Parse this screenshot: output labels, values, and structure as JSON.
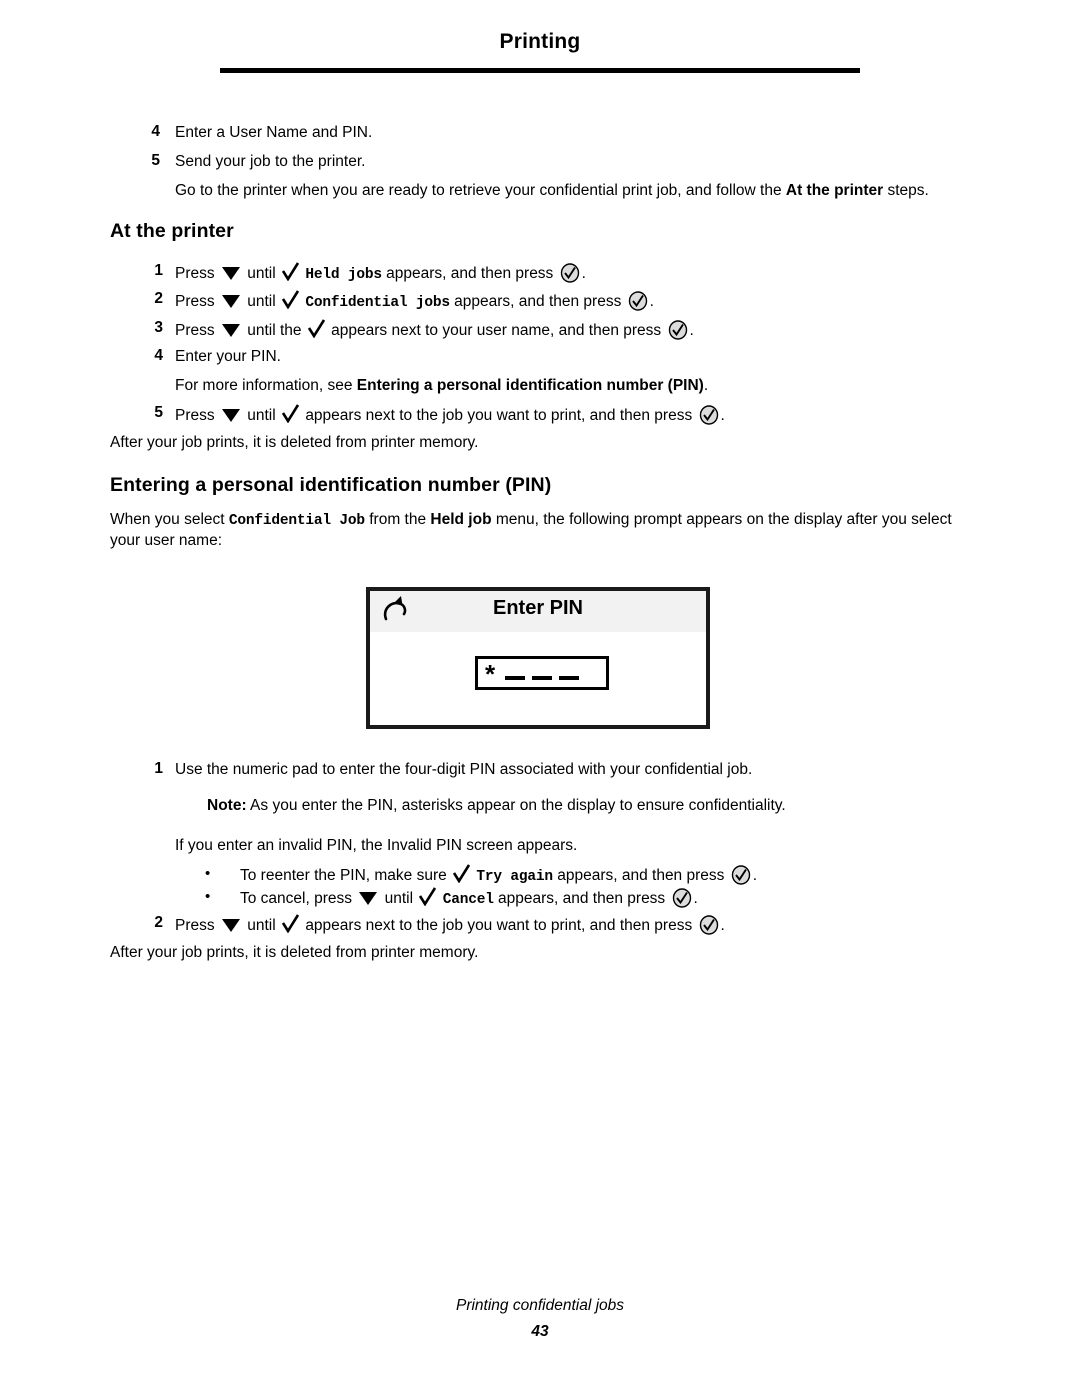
{
  "header": {
    "title": "Printing"
  },
  "intro_steps": [
    {
      "num": "4",
      "text": "Enter a User Name and PIN."
    },
    {
      "num": "5",
      "text": "Send your job to the printer."
    }
  ],
  "intro_paragraph": {
    "lead": "Go to the printer when you are ready to retrieve your confidential print job, and follow the ",
    "bold": "At the printer",
    "tail": " steps."
  },
  "at_printer": {
    "heading": "At the printer",
    "steps": [
      {
        "num": "1",
        "pre": "Press",
        "mid": "until",
        "mono": "Held jobs",
        "post": "appears, and then press",
        "end": "."
      },
      {
        "num": "2",
        "pre": "Press",
        "mid": "until",
        "mono": "Confidential jobs",
        "post": "appears, and then press",
        "end": "."
      },
      {
        "num": "3",
        "pre": "Press",
        "mid": "until the",
        "mono": "",
        "post": "appears next to your user name, and then press",
        "end": "."
      }
    ],
    "step4": {
      "num": "4",
      "text": "Enter your PIN."
    },
    "more_info": {
      "lead": "For more information, see ",
      "bold": "Entering a personal identification number (PIN)",
      "tail": "."
    },
    "step5": {
      "num": "5",
      "pre": "Press",
      "mid": "until",
      "post": "appears next to the job you want to print, and then press",
      "end": "."
    },
    "after_note": "After your job prints, it is deleted from printer memory."
  },
  "pin_section": {
    "heading": "Entering a personal identification number (PIN)",
    "paragraph": {
      "lead": "When you select ",
      "mono": "Confidential Job",
      "mid": " from the ",
      "bold": "Held job",
      "tail": " menu, the following prompt appears on the display after you select your user name:"
    },
    "display_panel": {
      "back_icon": "back-arrow-icon",
      "title": "Enter PIN",
      "pin_value": "*",
      "pin_placeholder_count": 3
    },
    "steps": [
      {
        "num": "1",
        "text": "Use the numeric pad to enter the four-digit PIN associated with your confidential job."
      }
    ],
    "note": {
      "label": "Note:",
      "text": " As you enter the PIN, asterisks appear on the display to ensure confidentiality."
    },
    "invalid_line": "If you enter an invalid PIN, the Invalid PIN screen appears.",
    "bullets": [
      {
        "marker": "•",
        "pre": "To reenter the PIN, make sure",
        "mono": "Try again",
        "post": "appears, and then press",
        "end": "."
      },
      {
        "marker": "•",
        "pre": "To cancel, press",
        "mid": "until",
        "mono": "Cancel",
        "post": "appears, and then press",
        "end": "."
      }
    ],
    "step2": {
      "num": "2",
      "pre": "Press",
      "mid": "until",
      "post": "appears next to the job you want to print, and then press",
      "end": "."
    },
    "after_note": "After your job prints, it is deleted from printer memory."
  },
  "footer": {
    "title": "Printing confidential jobs",
    "page_number": "43"
  },
  "colors": {
    "text": "#000000",
    "panel_titlebar": "#f2f2f2",
    "panel_border": "#1a1a1a",
    "rule": "#000000"
  }
}
